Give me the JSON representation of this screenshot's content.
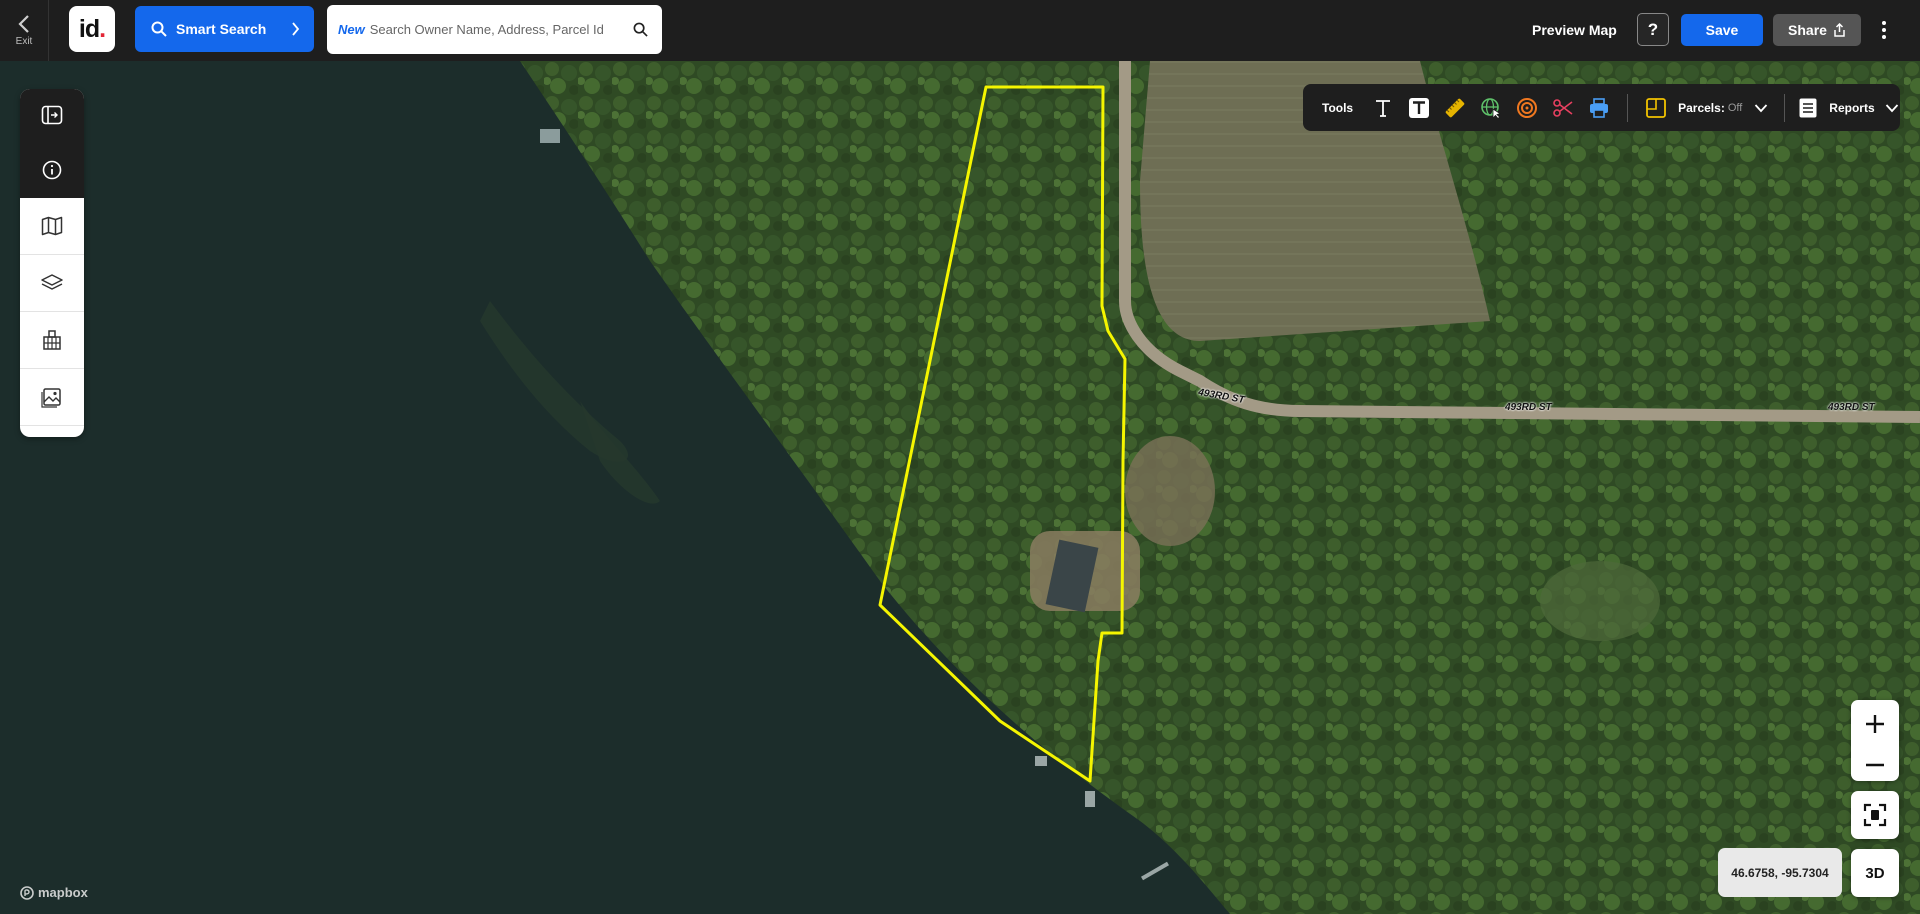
{
  "topbar": {
    "exit_label": "Exit",
    "logo_text": "id",
    "logo_dot": ".",
    "smart_search_label": "Smart Search",
    "search_new_badge": "New",
    "search_placeholder": "Search Owner Name, Address, Parcel Id",
    "preview_map_label": "Preview Map",
    "help_label": "?",
    "save_label": "Save",
    "share_label": "Share"
  },
  "left_rail": {
    "items": [
      "collapse-panel-icon",
      "info-icon",
      "map-icon",
      "layers-icon",
      "buildings-icon",
      "image-icon"
    ]
  },
  "tools_bar": {
    "label": "Tools",
    "icons": [
      "text-icon",
      "text-box-icon",
      "ruler-icon",
      "globe-cursor-icon",
      "radius-icon",
      "scissors-icon",
      "print-icon"
    ],
    "parcels_label": "Parcels:",
    "parcels_state": "Off",
    "reports_label": "Reports"
  },
  "map": {
    "road_labels": [
      "493RD ST",
      "493RD ST",
      "493RD ST"
    ],
    "parcel_outline_color": "#f5f500",
    "coordinates": "46.6758, -95.7304",
    "three_d_label": "3D",
    "attribution": "mapbox"
  },
  "colors": {
    "accent": "#1468ec",
    "topbar": "#1e1e1e",
    "logo_dot": "#e32636"
  }
}
